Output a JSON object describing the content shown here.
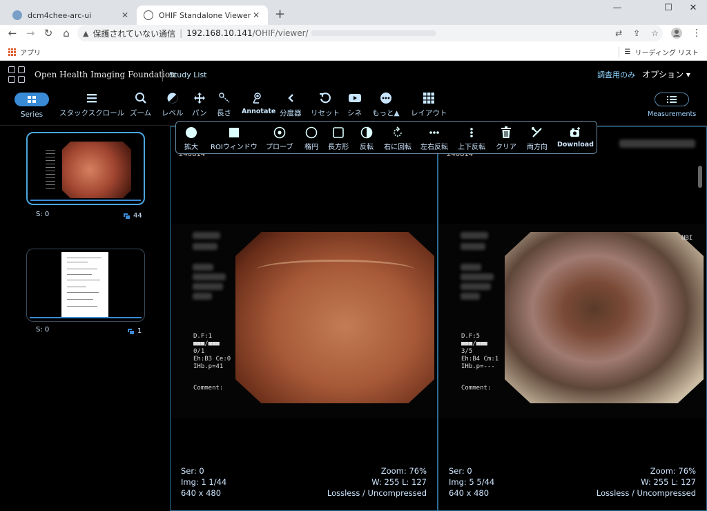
{
  "browser": {
    "tabs": [
      {
        "title": "dcm4chee-arc-ui",
        "close": "✕"
      },
      {
        "title": "OHIF Standalone Viewer",
        "close": "✕"
      }
    ],
    "new_tab": "+",
    "window": {
      "minimize": "—",
      "maximize": "☐",
      "close": "✕"
    },
    "nav": {
      "back": "←",
      "forward": "→",
      "reload": "↻",
      "home": "⌂"
    },
    "address": {
      "warning_icon": "▲",
      "security_text": "保護されていない通信",
      "separator": "|",
      "host": "192.168.10.141",
      "path": "/OHIF/viewer/"
    },
    "address_icons": {
      "translate": "⇄",
      "share": "⇪",
      "star": "☆"
    },
    "menu": "⋮",
    "bookmarks": {
      "apps": "アプリ",
      "reading_list": "リーディング リスト",
      "reading_icon": "☰"
    }
  },
  "header": {
    "brand": "Open Health Imaging Foundation",
    "study_list": "Study List",
    "research_only": "調査用のみ",
    "options": "オプション ▾"
  },
  "toolbar": [
    {
      "label": "Series",
      "icon": "grid-icon"
    },
    {
      "label": "スタックスクロール",
      "icon": "bars-icon"
    },
    {
      "label": "ズーム",
      "icon": "search-icon"
    },
    {
      "label": "レベル",
      "icon": "contrast-icon"
    },
    {
      "label": "パン",
      "icon": "move-icon"
    },
    {
      "label": "長さ",
      "icon": "measure-icon"
    },
    {
      "label": "Annotate",
      "icon": "annotate-icon"
    },
    {
      "label": "分度器",
      "icon": "angle-icon"
    },
    {
      "label": "リセット",
      "icon": "reset-icon"
    },
    {
      "label": "シネ",
      "icon": "play-icon"
    },
    {
      "label": "もっと▲",
      "icon": "more-icon"
    },
    {
      "label": "レイアウト",
      "icon": "layout-icon"
    },
    {
      "label": "Measurements",
      "icon": "list-icon"
    }
  ],
  "more_tools": [
    {
      "label": "拡大",
      "icon": "magnify-icon"
    },
    {
      "label": "ROIウィンドウ",
      "icon": "roi-icon"
    },
    {
      "label": "プローブ",
      "icon": "probe-icon"
    },
    {
      "label": "楕円",
      "icon": "ellipse-icon"
    },
    {
      "label": "長方形",
      "icon": "rectangle-icon"
    },
    {
      "label": "反転",
      "icon": "invert-icon"
    },
    {
      "label": "右に回転",
      "icon": "rotate-icon"
    },
    {
      "label": "左右反転",
      "icon": "flip-h-icon"
    },
    {
      "label": "上下反転",
      "icon": "flip-v-icon"
    },
    {
      "label": "クリア",
      "icon": "trash-icon"
    },
    {
      "label": "両方向",
      "icon": "bidirectional-icon"
    },
    {
      "label": "Download",
      "icon": "camera-icon"
    }
  ],
  "series": [
    {
      "s": "S: 0",
      "count": "44"
    },
    {
      "s": "S: 0",
      "count": "1"
    }
  ],
  "viewports": [
    {
      "id": "240814",
      "df": "D.F:1",
      "marks": "■■■/■■■",
      "frac": "0/1",
      "eh": "Eh:B3 Ce:0",
      "ihb": "IHb.p=41",
      "comment": "Comment:",
      "ser": "Ser: 0",
      "img": "Img: 1 1/44",
      "size": "640 x 480",
      "zoom": "Zoom: 76%",
      "wl": "W: 255 L: 127",
      "comp": "Lossless / Uncompressed"
    },
    {
      "id": "240814",
      "nbi": "NBI",
      "df": "D.F:5",
      "marks": "■■■/■■■",
      "frac": "3/5",
      "eh": "Eh:B4 Cm:1",
      "ihb": "IHb.p=---",
      "comment": "Comment:",
      "ser": "Ser: 0",
      "img": "Img: 5 5/44",
      "size": "640 x 480",
      "zoom": "Zoom: 76%",
      "wl": "W: 255 L: 127",
      "comp": "Lossless / Uncompressed"
    }
  ],
  "colors": {
    "accent": "#3a8bd6",
    "viewport_border": "#2b6d92",
    "overlay_text": "#cfe6ff"
  }
}
